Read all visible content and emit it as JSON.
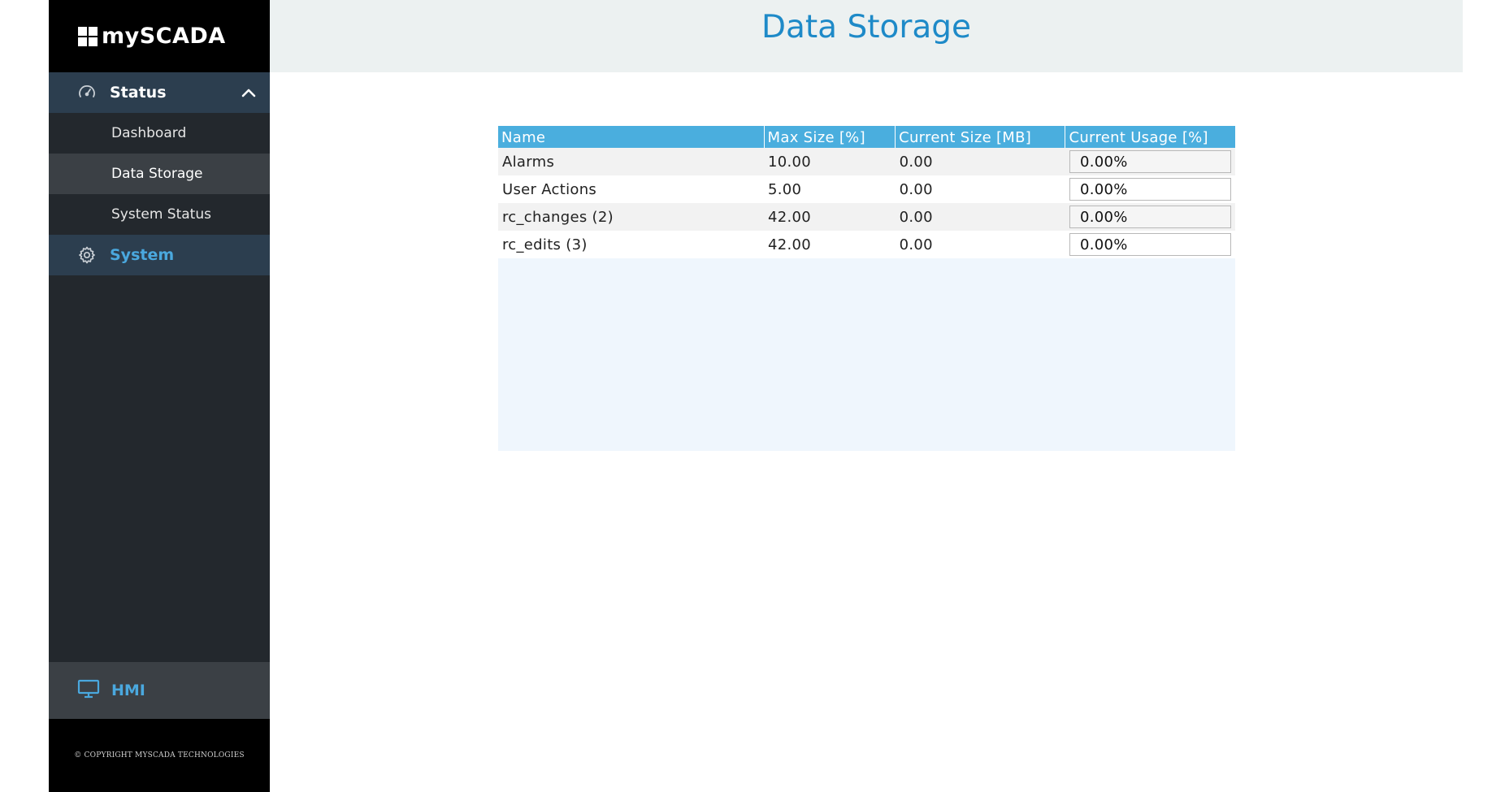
{
  "brand": {
    "name": "mySCADA"
  },
  "sidebar": {
    "status_group": {
      "label": "Status",
      "icon": "gauge-icon",
      "expanded": true
    },
    "status_items": [
      {
        "label": "Dashboard",
        "active": false
      },
      {
        "label": "Data Storage",
        "active": true
      },
      {
        "label": "System Status",
        "active": false
      }
    ],
    "system_group": {
      "label": "System",
      "icon": "gear-icon"
    },
    "hmi": {
      "label": "HMI",
      "icon": "monitor-icon"
    },
    "copyright": "© COPYRIGHT MYSCADA TECHNOLOGIES"
  },
  "header": {
    "title": "Data Storage"
  },
  "table": {
    "columns": [
      "Name",
      "Max Size [%]",
      "Current Size [MB]",
      "Current Usage [%]"
    ],
    "rows": [
      {
        "name": "Alarms",
        "max_size": "10.00",
        "current_size": "0.00",
        "usage": "0.00%"
      },
      {
        "name": "User Actions",
        "max_size": "5.00",
        "current_size": "0.00",
        "usage": "0.00%"
      },
      {
        "name": "rc_changes (2)",
        "max_size": "42.00",
        "current_size": "0.00",
        "usage": "0.00%"
      },
      {
        "name": "rc_edits (3)",
        "max_size": "42.00",
        "current_size": "0.00",
        "usage": "0.00%"
      }
    ]
  },
  "colors": {
    "accent": "#1e8ac8",
    "table_header": "#4aaede",
    "sidebar_bg": "#23282d",
    "group_bg": "#2c3e4f",
    "system_label": "#4aa8de"
  }
}
